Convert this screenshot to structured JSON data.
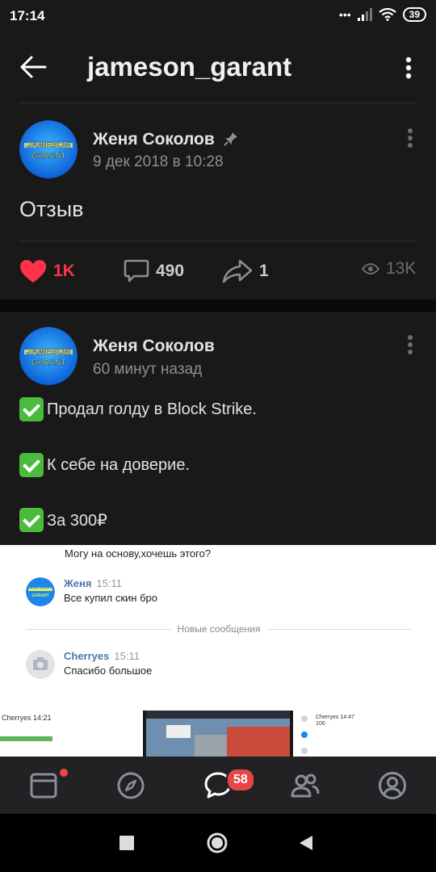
{
  "status_bar": {
    "time": "17:14",
    "battery": "39"
  },
  "app_bar": {
    "title": "jameson_garant"
  },
  "avatar_text": "JAMESON GARANT",
  "post1": {
    "author": "Женя Соколов",
    "date": "9 дек 2018 в 10:28",
    "text": "Отзыв",
    "likes": "1K",
    "comments": "490",
    "shares": "1",
    "views": "13K",
    "colors": {
      "like": "#ff3347",
      "muted": "#8a8f96"
    }
  },
  "post2": {
    "author": "Женя Соколов",
    "time": "60 минут назад",
    "lines": [
      "Продал голду в Block Strike.",
      "К себе на доверие.",
      "За 300₽"
    ]
  },
  "screenshot": {
    "top_text": "Могу на основу,хочешь этого?",
    "msg1": {
      "name": "Женя",
      "time": "15:11",
      "text": "Все купил скин бро"
    },
    "new_messages": "Новые сообщения",
    "msg2": {
      "name": "Cherryes",
      "time": "15:11",
      "text": "Спасибо большое"
    }
  },
  "thumbs": {
    "t1": "Cherryes 14:21",
    "t3a": "Cherryes 14:47",
    "t3b": "100"
  },
  "tab_bar": {
    "messages_badge": "58"
  }
}
